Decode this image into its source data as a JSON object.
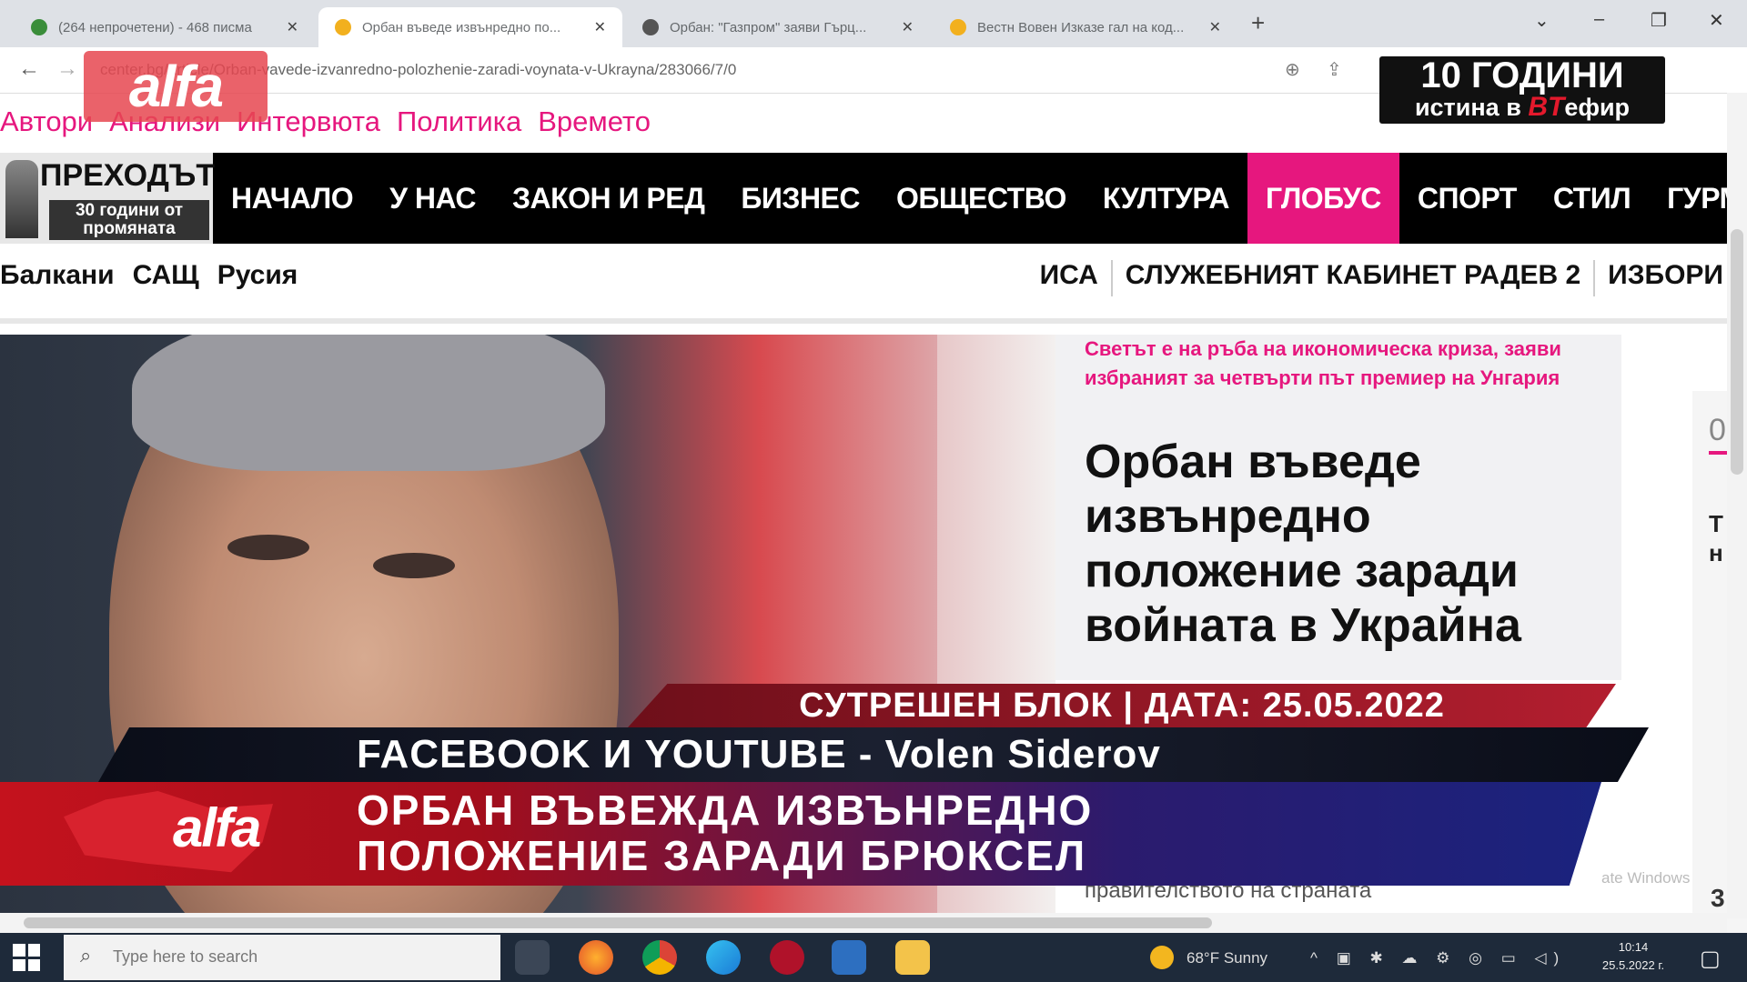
{
  "browser": {
    "tabs": [
      {
        "title": "(264 непрочетени) - 468 писма",
        "fav": "#3a8d3a"
      },
      {
        "title": "Орбан въведе извънредно по...",
        "fav": "#f2b01e"
      },
      {
        "title": "Орбан: \"Газпром\" заяви Гърц...",
        "fav": "#555"
      },
      {
        "title": "Вестн Вовен Изказе гал на код...",
        "fav": "#f2b01e"
      }
    ],
    "new_tab": "+",
    "close_glyph": "✕",
    "url": "center.bg/article/Orban-vavede-izvanredno-polozhenie-zaradi-voynata-v-Ukrayna/283066/7/0",
    "back": "←",
    "forward": "→"
  },
  "overlay_logo": "alfa",
  "tv_badge": {
    "line1": "10 ГОДИНИ",
    "line2_pre": "истина в ",
    "line2_bt": "BT",
    "line2_post": "ефир"
  },
  "site": {
    "top_links": [
      "Автори",
      "Анализи",
      "Интервюта",
      "Политика",
      "Времето"
    ],
    "logo_title": "ПРЕХОДЪТ",
    "logo_sub": "30 години от промяната",
    "nav": [
      "НАЧАЛО",
      "У НАС",
      "ЗАКОН И РЕД",
      "БИЗНЕС",
      "ОБЩЕСТВО",
      "КУЛТУРА",
      "ГЛОБУС",
      "СПОРТ",
      "СТИЛ",
      "ГУРМЕ"
    ],
    "nav_active": "ГЛОБУС",
    "sub_left": [
      "Балкани",
      "САЩ",
      "Русия"
    ],
    "sub_right": [
      "ИСА",
      "СЛУЖЕБНИЯТ КАБИНЕТ РАДЕВ 2",
      "ИЗБОРИ"
    ]
  },
  "article": {
    "kicker": "Светът е на ръба на икономическа криза, заяви избраният за четвърти път премиер на Унгария",
    "headline": "Орбан въведе извънредно положение заради войната в Украйна",
    "below_text": "правителството на страната",
    "side_number": "0",
    "side_text": "Т у н",
    "side_count": "3"
  },
  "tv": {
    "block": "СУТРЕШЕН БЛОК | ДАТА: 25.05.2022",
    "social": "FACEBOOK И YOUTUBE - Volen Siderov",
    "main_line1": "ОРБАН ВЪВЕЖДА ИЗВЪНРЕДНО",
    "main_line2": "ПОЛОЖЕНИЕ ЗАРАДИ БРЮКСЕЛ",
    "activate": "ate Windows"
  },
  "taskbar": {
    "search_placeholder": "Type here to search",
    "weather": "68°F  Sunny",
    "time": "10:14",
    "date": "25.5.2022 г."
  }
}
